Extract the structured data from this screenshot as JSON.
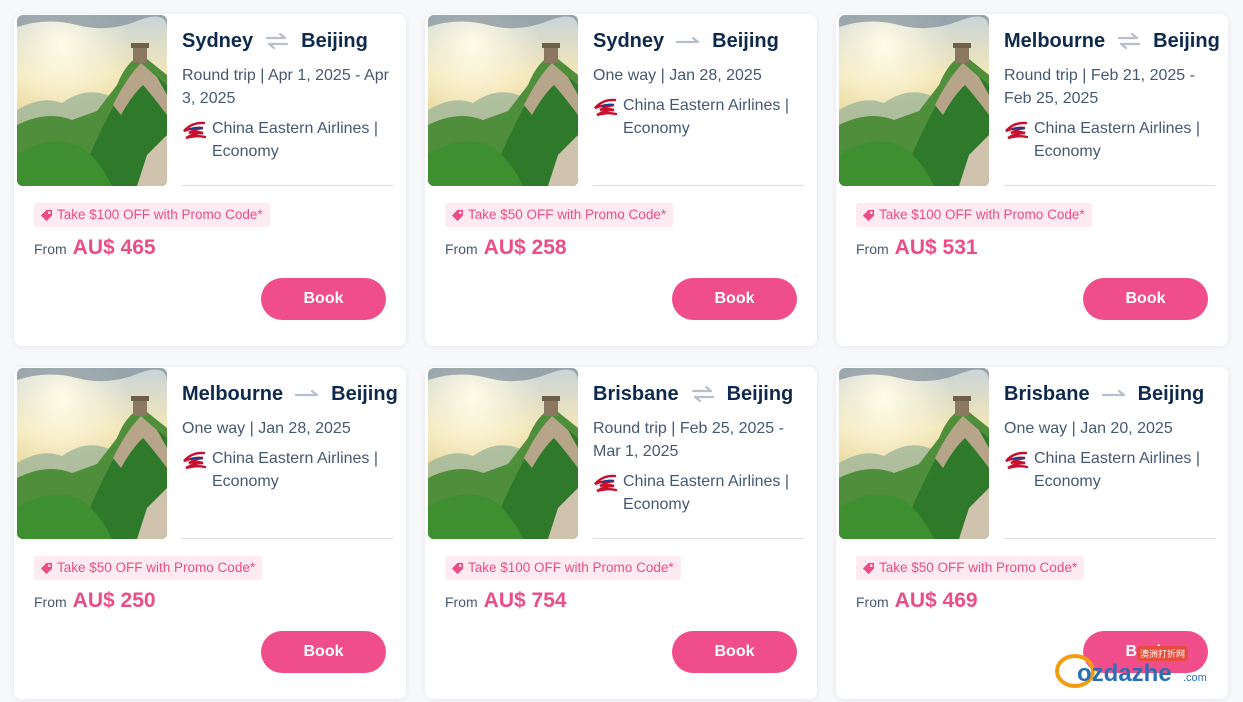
{
  "cards": [
    {
      "from_city": "Sydney",
      "to_city": "Beijing",
      "trip_type": "roundtrip",
      "trip": "Round trip | Apr 1, 2025 - Apr 3, 2025",
      "airline": "China Eastern Airlines | Economy",
      "promo": "Take $100 OFF with Promo Code*",
      "from_label": "From",
      "price": "AU$ 465",
      "book_label": "Book"
    },
    {
      "from_city": "Sydney",
      "to_city": "Beijing",
      "trip_type": "oneway",
      "trip": "One way | Jan 28, 2025",
      "airline": "China Eastern Airlines | Economy",
      "promo": "Take $50 OFF with Promo Code*",
      "from_label": "From",
      "price": "AU$ 258",
      "book_label": "Book"
    },
    {
      "from_city": "Melbourne",
      "to_city": "Beijing",
      "trip_type": "roundtrip",
      "trip": "Round trip | Feb 21, 2025 - Feb 25, 2025",
      "airline": "China Eastern Airlines | Economy",
      "promo": "Take $100 OFF with Promo Code*",
      "from_label": "From",
      "price": "AU$ 531",
      "book_label": "Book"
    },
    {
      "from_city": "Melbourne",
      "to_city": "Beijing",
      "trip_type": "oneway",
      "trip": "One way | Jan 28, 2025",
      "airline": "China Eastern Airlines | Economy",
      "promo": "Take $50 OFF with Promo Code*",
      "from_label": "From",
      "price": "AU$ 250",
      "book_label": "Book"
    },
    {
      "from_city": "Brisbane",
      "to_city": "Beijing",
      "trip_type": "roundtrip",
      "trip": "Round trip | Feb 25, 2025 - Mar 1, 2025",
      "airline": "China Eastern Airlines | Economy",
      "promo": "Take $100 OFF with Promo Code*",
      "from_label": "From",
      "price": "AU$ 754",
      "book_label": "Book"
    },
    {
      "from_city": "Brisbane",
      "to_city": "Beijing",
      "trip_type": "oneway",
      "trip": "One way | Jan 20, 2025",
      "airline": "China Eastern Airlines | Economy",
      "promo": "Take $50 OFF with Promo Code*",
      "from_label": "From",
      "price": "AU$ 469",
      "book_label": "Book"
    }
  ],
  "icons": {
    "roundtrip": "roundtrip-arrows-icon",
    "oneway": "oneway-arrow-icon",
    "airline": "china-eastern-logo-icon",
    "promo": "price-tag-icon"
  },
  "colors": {
    "accent": "#f04e8a",
    "price": "#eb4d87",
    "promo_bg": "#fdebf1",
    "title": "#0f294d",
    "text": "#455873"
  },
  "watermark": {
    "text": "ozdazhe",
    "suffix": ".com",
    "badge": "澳洲打折网"
  }
}
